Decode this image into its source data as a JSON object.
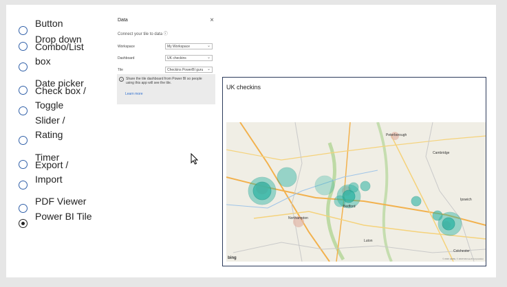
{
  "options": [
    {
      "label": "Button",
      "selected": false
    },
    {
      "label": "Drop down",
      "selected": false
    },
    {
      "label": "Combo/List box",
      "selected": false
    },
    {
      "label": "Date picker",
      "selected": false
    },
    {
      "label": "Check box / Toggle",
      "selected": false
    },
    {
      "label": "Slider / Rating",
      "selected": false
    },
    {
      "label": "Timer",
      "selected": false
    },
    {
      "label": "Export / Import",
      "selected": false
    },
    {
      "label": "PDF Viewer",
      "selected": false
    },
    {
      "label": "Power BI Tile",
      "selected": true
    }
  ],
  "data_panel": {
    "title": "Data",
    "close_glyph": "×",
    "subtitle": "Connect your tile to data",
    "fields": [
      {
        "label": "Workspace",
        "value": "My Workspace"
      },
      {
        "label": "Dashboard",
        "value": "UK checkins"
      },
      {
        "label": "Tile",
        "value": "Checkins PowerBI guru"
      }
    ],
    "info_text": "Share the tile dashboard from Power BI so people using this app will see the tile.",
    "learn_more": "Learn more"
  },
  "tile": {
    "title": "UK checkins",
    "map_labels": [
      "Peterborough",
      "Cambridge",
      "Northampton",
      "Bedford",
      "Luton",
      "Ipswich",
      "Colchester"
    ],
    "map_logo": "bing",
    "map_copyright": "© 2020 HERE, © 2020 Microsoft Corporation"
  },
  "colors": {
    "radio": "#2f5fa8",
    "bubble": "#2bb3a3",
    "tile_border": "#2b3a5a",
    "link": "#2f6fcf"
  }
}
